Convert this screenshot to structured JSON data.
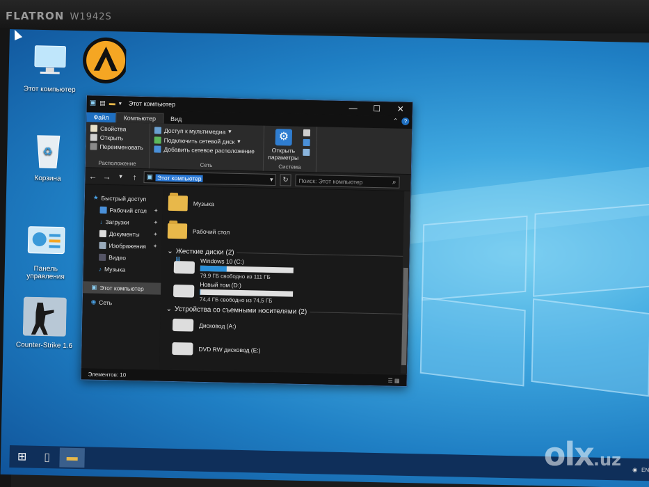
{
  "monitor": {
    "brand": "FLATRON",
    "model": "W1942S"
  },
  "desktop": {
    "icons": [
      {
        "label": "Этот компьютер"
      },
      {
        "label": "Корзина"
      },
      {
        "label": "Панель управления"
      },
      {
        "label": "Counter-Strike 1.6"
      }
    ]
  },
  "explorer": {
    "title": "Этот компьютер",
    "window_controls": {
      "minimize": "—",
      "maximize": "☐",
      "close": "✕"
    },
    "tabs": [
      "Файл",
      "Компьютер",
      "Вид"
    ],
    "ribbon": {
      "location_group": {
        "name": "Расположение",
        "items": [
          "Свойства",
          "Открыть",
          "Переименовать"
        ]
      },
      "network_group": {
        "name": "Сеть",
        "items": [
          "Доступ к мультимедиа",
          "Подключить сетевой диск",
          "Добавить сетевое расположение"
        ]
      },
      "system_group": {
        "name": "Система",
        "open_settings": "Открыть параметры"
      }
    },
    "address": {
      "path": "Этот компьютер",
      "search_placeholder": "Поиск: Этот компьютер"
    },
    "nav_pane": {
      "quick_access": "Быстрый доступ",
      "items": [
        "Рабочий стол",
        "Загрузки",
        "Документы",
        "Изображения",
        "Видео",
        "Музыка"
      ],
      "this_pc": "Этот компьютер",
      "network": "Сеть"
    },
    "folders": [
      "Музыка",
      "Рабочий стол"
    ],
    "hard_drives": {
      "header": "Жесткие диски (2)",
      "items": [
        {
          "name": "Windows 10 (C:)",
          "free": "79,9 ГБ свободно из 111 ГБ",
          "used_fraction": 0.28
        },
        {
          "name": "Новый том (D:)",
          "free": "74,4 ГБ свободно из 74,5 ГБ",
          "used_fraction": 0.01
        }
      ]
    },
    "removable": {
      "header": "Устройства со съемными носителями (2)",
      "items": [
        {
          "name": "Дисковод (A:)"
        },
        {
          "name": "DVD RW дисковод (E:)"
        }
      ]
    },
    "status": {
      "items_count": "Элементов: 10"
    }
  },
  "taskbar": {
    "lang": "ENG"
  },
  "watermark": {
    "text": "olx",
    "suffix": ".uz"
  },
  "colors": {
    "accent": "#1f6fc0",
    "desktop": "#1f7fc4",
    "window_bg": "#1a1a1a"
  }
}
